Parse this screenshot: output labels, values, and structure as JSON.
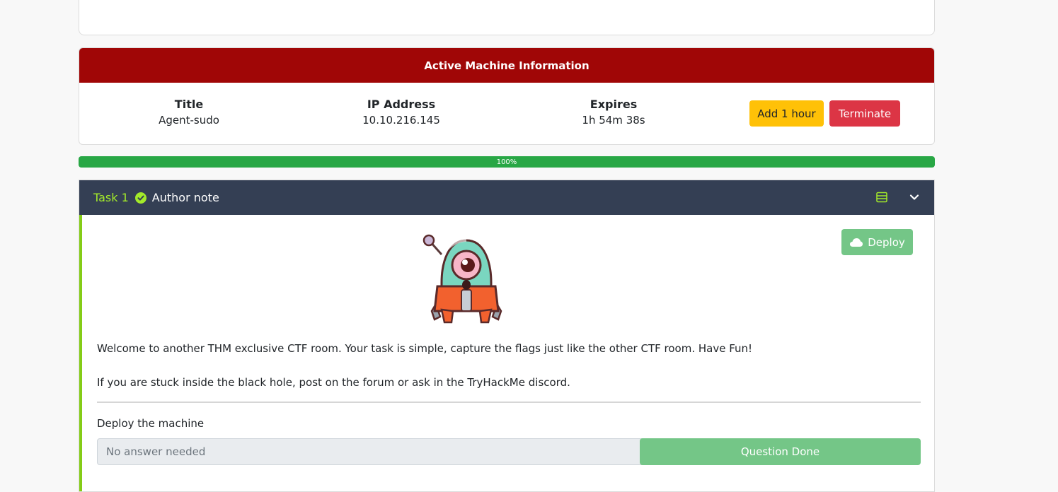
{
  "machine": {
    "header": "Active Machine Information",
    "title_label": "Title",
    "title_value": "Agent-sudo",
    "ip_label": "IP Address",
    "ip_value": "10.10.216.145",
    "expires_label": "Expires",
    "expires_value": "1h 54m 38s",
    "add_hour_label": "Add 1 hour",
    "terminate_label": "Terminate"
  },
  "progress": {
    "label": "100%",
    "value": 100
  },
  "task": {
    "number_label": "Task 1",
    "title": "Author note",
    "deploy_label": "Deploy",
    "paragraph1": "Welcome to another THM exclusive CTF room. Your task is simple, capture the flags just like the other CTF room. Have Fun!",
    "paragraph2": "If you are stuck inside the black hole, post on the forum or ask in the TryHackMe discord.",
    "question": "Deploy the machine",
    "answer_placeholder": "No answer needed",
    "done_label": "Question Done"
  },
  "colors": {
    "machine_header": "#a00606",
    "task_header": "#343f54",
    "accent_green": "#a3ea2a",
    "progress": "#28a745",
    "add_hour": "#ffc107",
    "terminate": "#dc3545",
    "done": "#74c687"
  },
  "icons": [
    "check-circle-icon",
    "list-icon",
    "chevron-down-icon",
    "cloud-icon"
  ]
}
